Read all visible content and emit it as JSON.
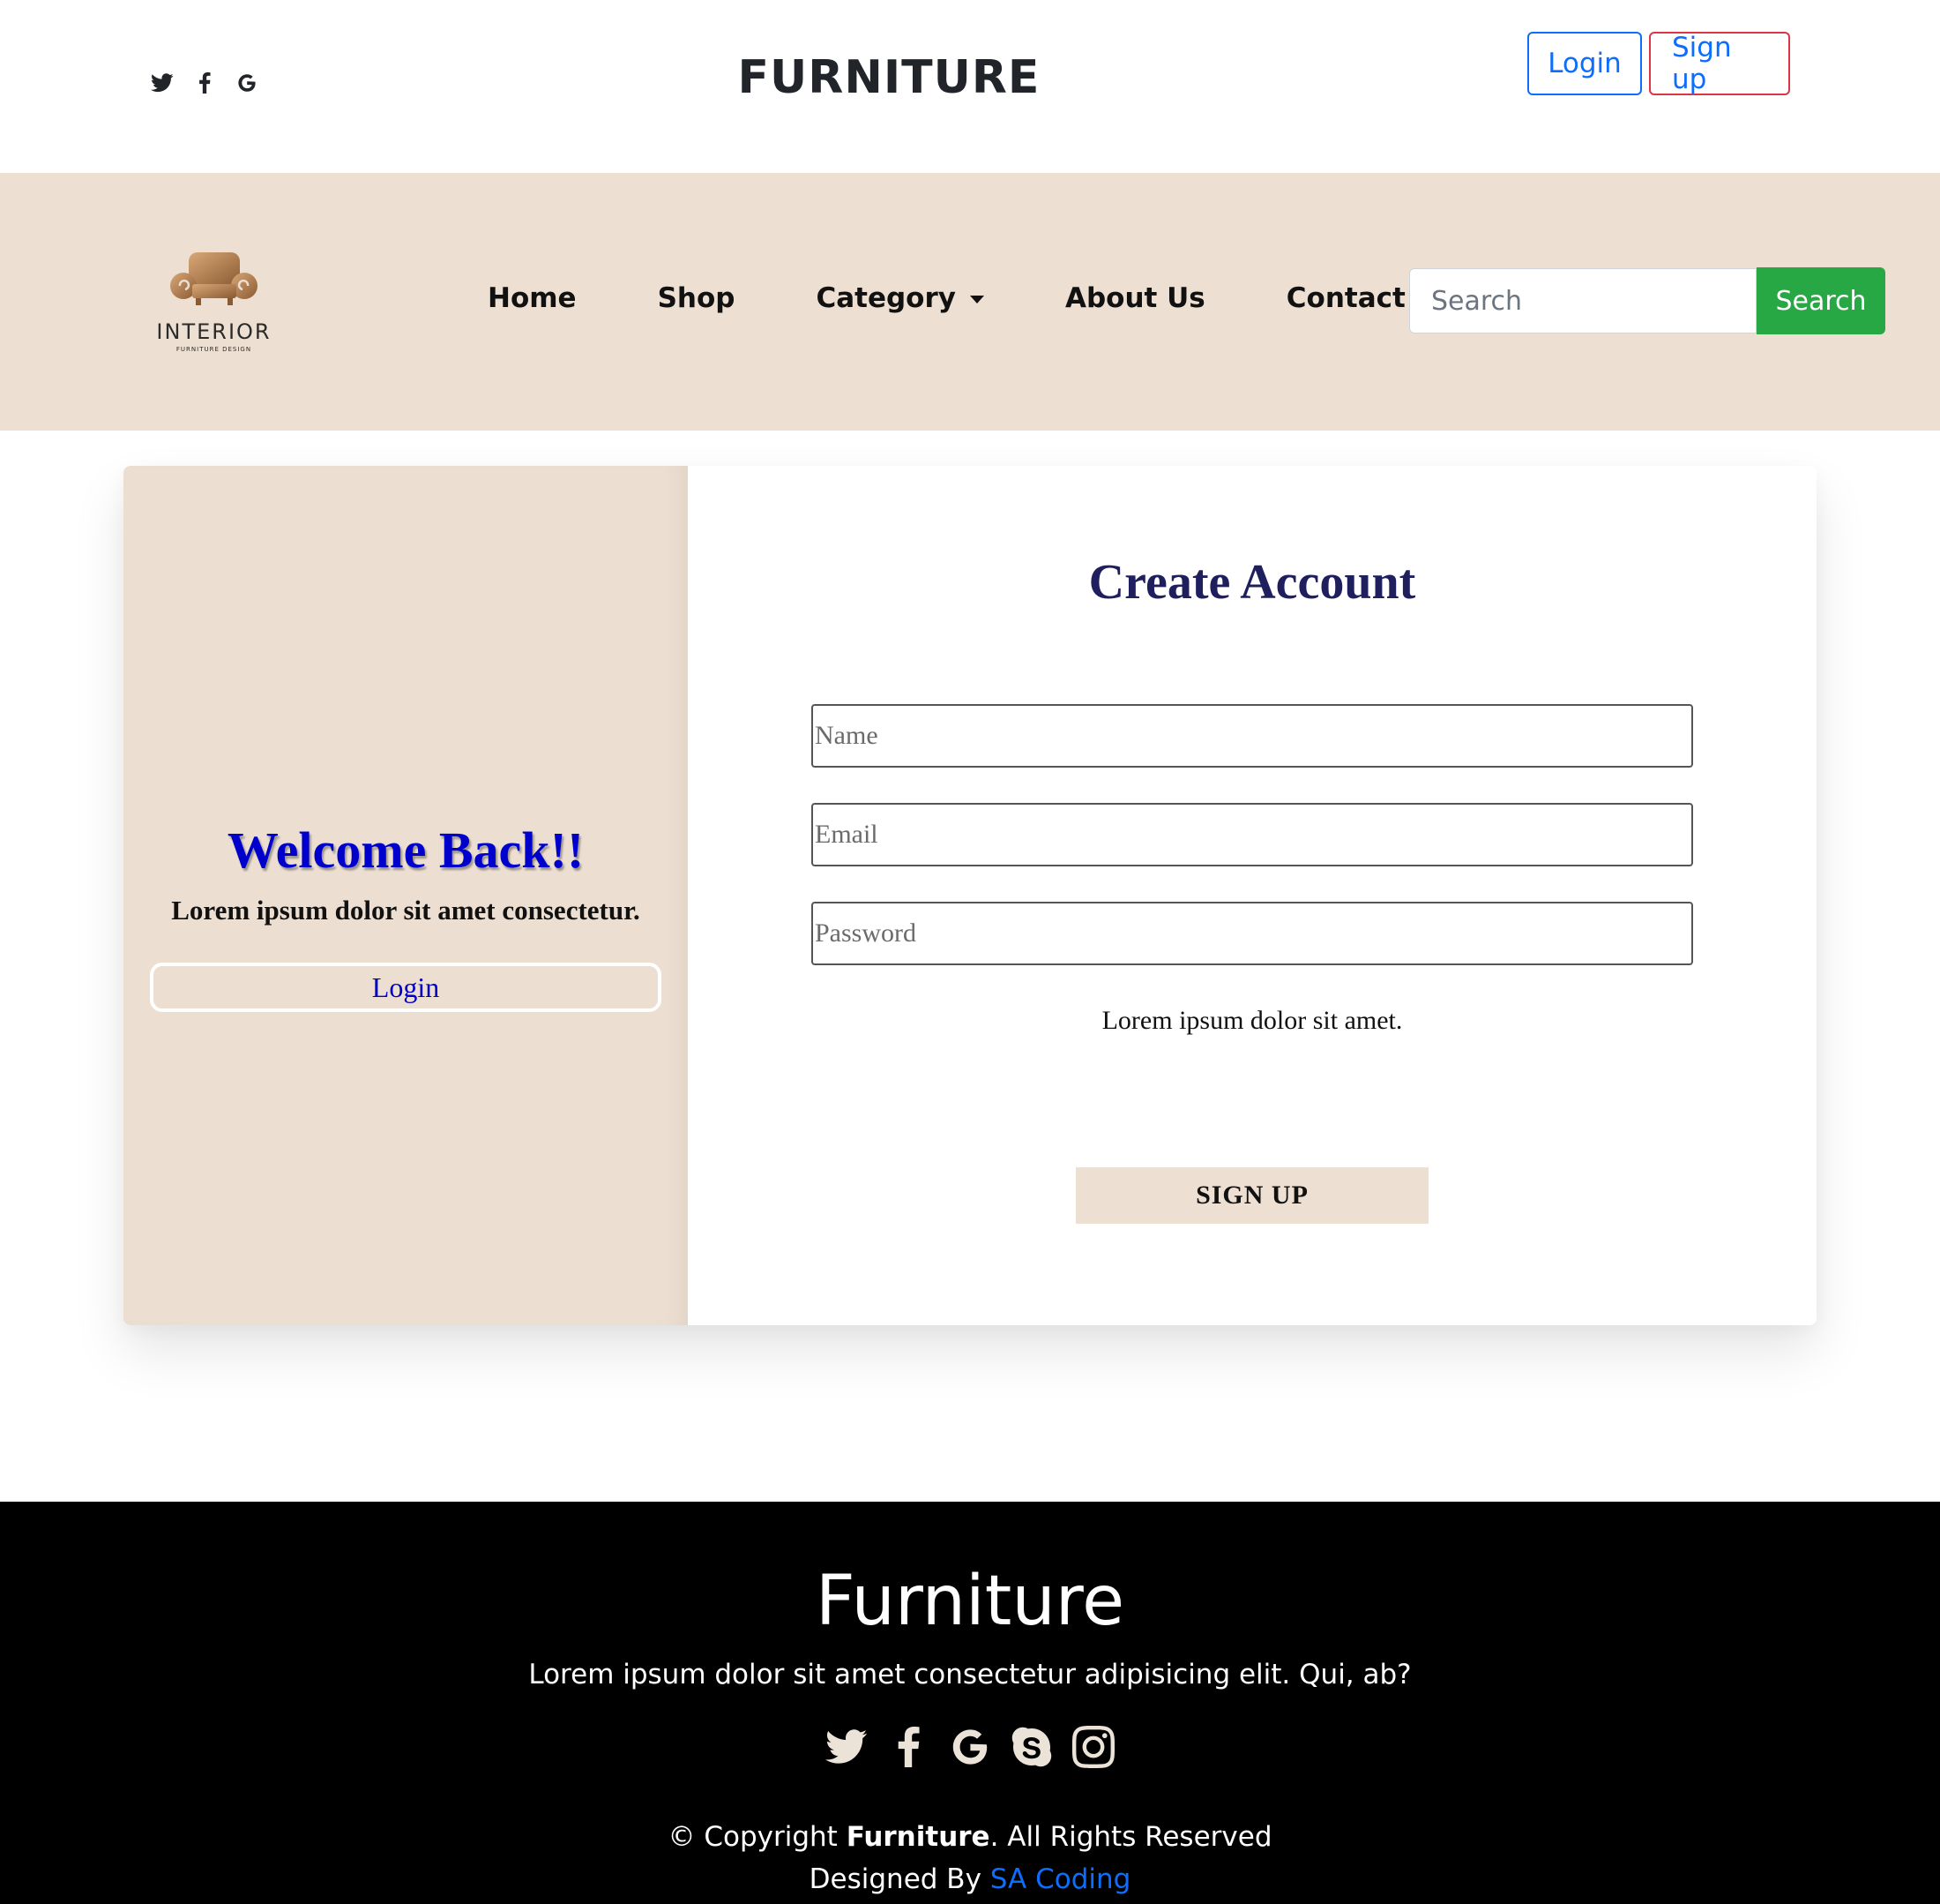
{
  "header": {
    "brand": "FURNITURE",
    "social_icons": [
      "twitter-icon",
      "facebook-icon",
      "google-icon"
    ],
    "login_label": "Login",
    "signup_label": "Sign up"
  },
  "navbar": {
    "logo": {
      "name": "INTERIOR",
      "subtitle": "FURNITURE DESIGN"
    },
    "links": [
      "Home",
      "Shop",
      "Category",
      "About Us",
      "Contact Us"
    ],
    "search": {
      "placeholder": "Search",
      "button_label": "Search"
    }
  },
  "welcome_panel": {
    "title": "Welcome Back!!",
    "subtitle": "Lorem ipsum dolor sit amet consectetur.",
    "login_label": "Login"
  },
  "form": {
    "title": "Create Account",
    "name_placeholder": "Name",
    "email_placeholder": "Email",
    "password_placeholder": "Password",
    "note": "Lorem ipsum dolor sit amet.",
    "submit_label": "SIGN UP"
  },
  "footer": {
    "title": "Furniture",
    "description": "Lorem ipsum dolor sit amet consectetur adipisicing elit. Qui, ab?",
    "social_icons": [
      "twitter-icon",
      "facebook-icon",
      "google-icon",
      "skype-icon",
      "instagram-icon"
    ],
    "copyright_prefix": "© Copyright ",
    "copyright_brand": "Furniture",
    "copyright_suffix": ". All Rights Reserved",
    "designed_by_prefix": "Designed By ",
    "designed_by_link": "SA Coding"
  },
  "colors": {
    "beige": "#ede0d2",
    "search_green": "#28a745",
    "primary_blue": "#0d6efd",
    "danger_red": "#dc3545",
    "welcome_blue": "#0000cc",
    "title_navy": "#1f1f5e",
    "footer_bg": "#000000"
  }
}
